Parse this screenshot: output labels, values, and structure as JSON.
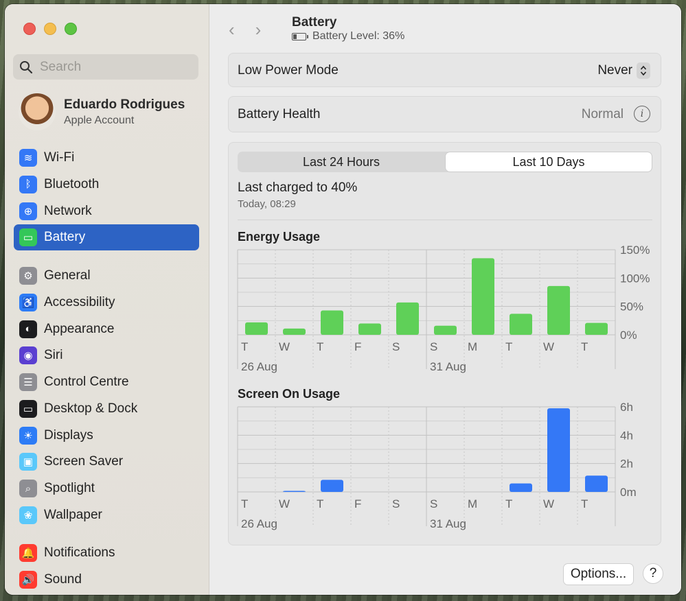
{
  "sidebar": {
    "search_placeholder": "Search",
    "account": {
      "name": "Eduardo Rodrigues",
      "subtitle": "Apple Account"
    },
    "group1": [
      {
        "label": "Wi-Fi",
        "icon": "wifi-icon",
        "color": "#3478f6",
        "glyph": "≋"
      },
      {
        "label": "Bluetooth",
        "icon": "bluetooth-icon",
        "color": "#3478f6",
        "glyph": "ᛒ"
      },
      {
        "label": "Network",
        "icon": "globe-icon",
        "color": "#3478f6",
        "glyph": "⊕"
      },
      {
        "label": "Battery",
        "icon": "battery-icon",
        "color": "#34c759",
        "glyph": "▭",
        "active": true
      }
    ],
    "group2": [
      {
        "label": "General",
        "icon": "gear-icon",
        "color": "#8e8e93",
        "glyph": "⚙"
      },
      {
        "label": "Accessibility",
        "icon": "accessibility-icon",
        "color": "#2d7cf6",
        "glyph": "♿"
      },
      {
        "label": "Appearance",
        "icon": "appearance-icon",
        "color": "#1c1c1e",
        "glyph": "◐"
      },
      {
        "label": "Siri",
        "icon": "siri-icon",
        "color": "#5a3fd1",
        "glyph": "◉"
      },
      {
        "label": "Control Centre",
        "icon": "control-centre-icon",
        "color": "#8e8e93",
        "glyph": "☰"
      },
      {
        "label": "Desktop & Dock",
        "icon": "dock-icon",
        "color": "#1c1c1e",
        "glyph": "▭"
      },
      {
        "label": "Displays",
        "icon": "displays-icon",
        "color": "#2d7cf6",
        "glyph": "☀"
      },
      {
        "label": "Screen Saver",
        "icon": "screen-saver-icon",
        "color": "#5ac8fa",
        "glyph": "▣"
      },
      {
        "label": "Spotlight",
        "icon": "spotlight-icon",
        "color": "#8e8e93",
        "glyph": "⌕"
      },
      {
        "label": "Wallpaper",
        "icon": "wallpaper-icon",
        "color": "#5ac8fa",
        "glyph": "❀"
      }
    ],
    "group3": [
      {
        "label": "Notifications",
        "icon": "notifications-icon",
        "color": "#ff3b30",
        "glyph": "🔔"
      },
      {
        "label": "Sound",
        "icon": "sound-icon",
        "color": "#ff3b30",
        "glyph": "🔊"
      }
    ]
  },
  "header": {
    "back": "‹",
    "forward": "›",
    "title": "Battery",
    "subtitle": "Battery Level: 36%",
    "battery_level": 0.36
  },
  "low_power": {
    "label": "Low Power Mode",
    "value": "Never"
  },
  "health": {
    "label": "Battery Health",
    "value": "Normal"
  },
  "usage": {
    "tabs": [
      {
        "label": "Last 24 Hours",
        "selected": false
      },
      {
        "label": "Last 10 Days",
        "selected": true
      }
    ],
    "last_charged": "Last charged to 40%",
    "last_charged_time": "Today, 08:29"
  },
  "chart_data": [
    {
      "type": "bar",
      "title": "Energy Usage",
      "categories": [
        "T",
        "W",
        "T",
        "F",
        "S",
        "S",
        "M",
        "T",
        "W",
        "T"
      ],
      "date_labels": [
        "26 Aug",
        "31 Aug"
      ],
      "values": [
        22,
        11,
        43,
        20,
        57,
        16,
        135,
        37,
        86,
        21
      ],
      "yticks": [
        "150%",
        "100%",
        "50%",
        "0%"
      ],
      "ylim": [
        0,
        150
      ],
      "color": "#5fd058"
    },
    {
      "type": "bar",
      "title": "Screen On Usage",
      "categories": [
        "T",
        "W",
        "T",
        "F",
        "S",
        "S",
        "M",
        "T",
        "W",
        "T"
      ],
      "date_labels": [
        "26 Aug",
        "31 Aug"
      ],
      "values": [
        0,
        0.05,
        0.85,
        0,
        0,
        0,
        0,
        0.6,
        5.9,
        1.15
      ],
      "yticks": [
        "6h",
        "4h",
        "2h",
        "0m"
      ],
      "ylim": [
        0,
        6
      ],
      "color": "#3478f6"
    }
  ],
  "footer": {
    "options_label": "Options...",
    "help_label": "?"
  }
}
